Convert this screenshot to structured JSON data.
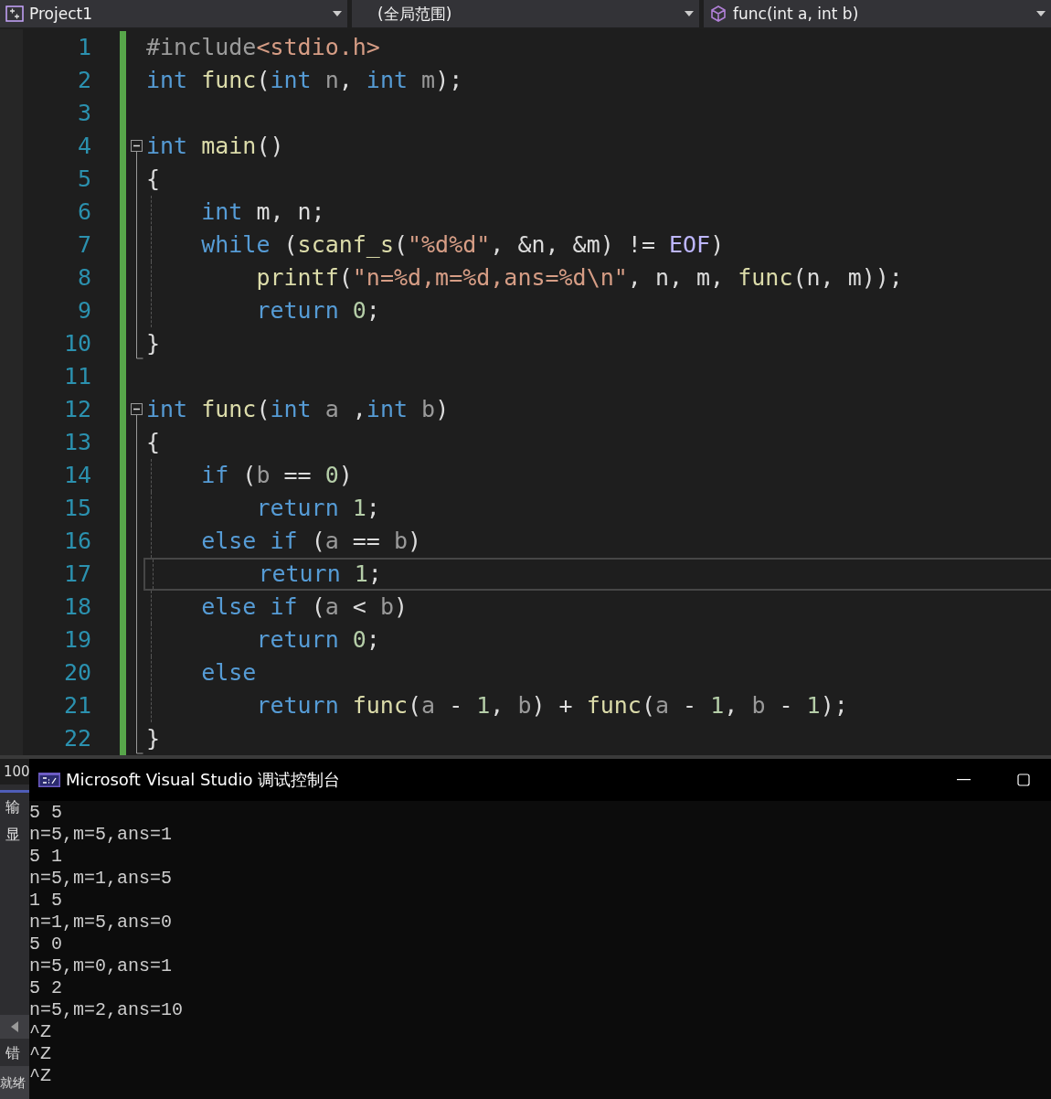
{
  "navigation_bar": {
    "dropdowns": [
      {
        "kind": "project",
        "label": "Project1"
      },
      {
        "kind": "scope",
        "label": "(全局范围)"
      },
      {
        "kind": "member",
        "label": "func(int a, int b)"
      }
    ]
  },
  "editor": {
    "lines": [
      {
        "number": "1",
        "changed": true,
        "current": false,
        "tokens": [
          {
            "kind": "preprocessor",
            "text": "#include"
          },
          {
            "kind": "string",
            "text": "<stdio.h>"
          }
        ]
      },
      {
        "number": "2",
        "changed": true,
        "current": false,
        "tokens": [
          {
            "kind": "keyword",
            "text": "int"
          },
          {
            "kind": "function",
            "text": " func"
          },
          {
            "kind": "plain",
            "text": "("
          },
          {
            "kind": "keyword",
            "text": "int"
          },
          {
            "kind": "param",
            "text": " n"
          },
          {
            "kind": "plain",
            "text": ", "
          },
          {
            "kind": "keyword",
            "text": "int"
          },
          {
            "kind": "param",
            "text": " m"
          },
          {
            "kind": "plain",
            "text": ");"
          }
        ]
      },
      {
        "number": "3",
        "changed": true,
        "current": false
      },
      {
        "number": "4",
        "changed": true,
        "current": false,
        "expanded": true,
        "tokens": [
          {
            "kind": "keyword",
            "text": "int"
          },
          {
            "kind": "function",
            "text": " main"
          },
          {
            "kind": "plain",
            "text": "()"
          }
        ],
        "children": [
          {
            "number": "5",
            "changed": true,
            "current": false,
            "tokens": [
              {
                "kind": "plain",
                "text": "{"
              }
            ]
          },
          {
            "number": "6",
            "changed": true,
            "current": false,
            "tokens": [
              {
                "kind": "keyword",
                "text": "    int"
              },
              {
                "kind": "plain",
                "text": " m, n;"
              }
            ]
          },
          {
            "number": "7",
            "changed": true,
            "current": false,
            "tokens": [
              {
                "kind": "keyword",
                "text": "    while"
              },
              {
                "kind": "plain",
                "text": " ("
              },
              {
                "kind": "function",
                "text": "scanf_s"
              },
              {
                "kind": "plain",
                "text": "("
              },
              {
                "kind": "string",
                "text": "\"%d%d\""
              },
              {
                "kind": "plain",
                "text": ", &n, &m) != "
              },
              {
                "kind": "macro",
                "text": "EOF"
              },
              {
                "kind": "plain",
                "text": ")"
              }
            ]
          },
          {
            "number": "8",
            "changed": true,
            "current": false,
            "tokens": [
              {
                "kind": "function",
                "text": "        printf"
              },
              {
                "kind": "plain",
                "text": "("
              },
              {
                "kind": "string",
                "text": "\"n=%d,m=%d,ans=%d\\n\""
              },
              {
                "kind": "plain",
                "text": ", n, m, "
              },
              {
                "kind": "function",
                "text": "func"
              },
              {
                "kind": "plain",
                "text": "(n, m));"
              }
            ]
          },
          {
            "number": "9",
            "changed": true,
            "current": false,
            "tokens": [
              {
                "kind": "keyword",
                "text": "        return"
              },
              {
                "kind": "number",
                "text": " 0"
              },
              {
                "kind": "plain",
                "text": ";"
              }
            ]
          },
          {
            "number": "10",
            "changed": true,
            "current": false,
            "tokens": [
              {
                "kind": "plain",
                "text": "}"
              }
            ]
          }
        ]
      },
      {
        "number": "11",
        "changed": true,
        "current": false
      },
      {
        "number": "12",
        "changed": true,
        "current": false,
        "expanded": true,
        "tokens": [
          {
            "kind": "keyword",
            "text": "int"
          },
          {
            "kind": "function",
            "text": " func"
          },
          {
            "kind": "plain",
            "text": "("
          },
          {
            "kind": "keyword",
            "text": "int"
          },
          {
            "kind": "param",
            "text": " a"
          },
          {
            "kind": "plain",
            "text": " ,"
          },
          {
            "kind": "keyword",
            "text": "int"
          },
          {
            "kind": "param",
            "text": " b"
          },
          {
            "kind": "plain",
            "text": ")"
          }
        ],
        "children": [
          {
            "number": "13",
            "changed": true,
            "current": false,
            "tokens": [
              {
                "kind": "plain",
                "text": "{"
              }
            ]
          },
          {
            "number": "14",
            "changed": true,
            "current": false,
            "tokens": [
              {
                "kind": "keyword",
                "text": "    if"
              },
              {
                "kind": "plain",
                "text": " ("
              },
              {
                "kind": "param",
                "text": "b"
              },
              {
                "kind": "plain",
                "text": " == "
              },
              {
                "kind": "number",
                "text": "0"
              },
              {
                "kind": "plain",
                "text": ")"
              }
            ]
          },
          {
            "number": "15",
            "changed": true,
            "current": false,
            "tokens": [
              {
                "kind": "keyword",
                "text": "        return"
              },
              {
                "kind": "number",
                "text": " 1"
              },
              {
                "kind": "plain",
                "text": ";"
              }
            ]
          },
          {
            "number": "16",
            "changed": true,
            "current": false,
            "tokens": [
              {
                "kind": "keyword",
                "text": "    else if"
              },
              {
                "kind": "plain",
                "text": " ("
              },
              {
                "kind": "param",
                "text": "a"
              },
              {
                "kind": "plain",
                "text": " == "
              },
              {
                "kind": "param",
                "text": "b"
              },
              {
                "kind": "plain",
                "text": ")"
              }
            ]
          },
          {
            "number": "17",
            "changed": true,
            "current": true,
            "tokens": [
              {
                "kind": "keyword",
                "text": "        return"
              },
              {
                "kind": "number",
                "text": " 1"
              },
              {
                "kind": "plain",
                "text": ";"
              }
            ]
          },
          {
            "number": "18",
            "changed": true,
            "current": false,
            "tokens": [
              {
                "kind": "keyword",
                "text": "    else if"
              },
              {
                "kind": "plain",
                "text": " ("
              },
              {
                "kind": "param",
                "text": "a"
              },
              {
                "kind": "plain",
                "text": " < "
              },
              {
                "kind": "param",
                "text": "b"
              },
              {
                "kind": "plain",
                "text": ")"
              }
            ]
          },
          {
            "number": "19",
            "changed": true,
            "current": false,
            "tokens": [
              {
                "kind": "keyword",
                "text": "        return"
              },
              {
                "kind": "number",
                "text": " 0"
              },
              {
                "kind": "plain",
                "text": ";"
              }
            ]
          },
          {
            "number": "20",
            "changed": true,
            "current": false,
            "tokens": [
              {
                "kind": "keyword",
                "text": "    else"
              }
            ]
          },
          {
            "number": "21",
            "changed": true,
            "current": false,
            "tokens": [
              {
                "kind": "keyword",
                "text": "        return"
              },
              {
                "kind": "function",
                "text": " func"
              },
              {
                "kind": "plain",
                "text": "("
              },
              {
                "kind": "param",
                "text": "a"
              },
              {
                "kind": "plain",
                "text": " - "
              },
              {
                "kind": "number",
                "text": "1"
              },
              {
                "kind": "plain",
                "text": ", "
              },
              {
                "kind": "param",
                "text": "b"
              },
              {
                "kind": "plain",
                "text": ") + "
              },
              {
                "kind": "function",
                "text": "func"
              },
              {
                "kind": "plain",
                "text": "("
              },
              {
                "kind": "param",
                "text": "a"
              },
              {
                "kind": "plain",
                "text": " - "
              },
              {
                "kind": "number",
                "text": "1"
              },
              {
                "kind": "plain",
                "text": ", "
              },
              {
                "kind": "param",
                "text": "b"
              },
              {
                "kind": "plain",
                "text": " - "
              },
              {
                "kind": "number",
                "text": "1"
              },
              {
                "kind": "plain",
                "text": ");"
              }
            ]
          },
          {
            "number": "22",
            "changed": true,
            "current": false,
            "tokens": [
              {
                "kind": "plain",
                "text": "}"
              }
            ]
          }
        ]
      }
    ]
  },
  "side_panel": {
    "zoom": "100",
    "output_tab": "输",
    "show_label": "显",
    "error_tab": "错",
    "status": "就绪"
  },
  "console": {
    "title": "Microsoft Visual Studio 调试控制台",
    "lines": [
      "5 5",
      "n=5,m=5,ans=1",
      "5 1",
      "n=5,m=1,ans=5",
      "1 5",
      "n=1,m=5,ans=0",
      "5 0",
      "n=5,m=0,ans=1",
      "5 2",
      "n=5,m=2,ans=10",
      "^Z",
      "^Z",
      "^Z"
    ]
  }
}
